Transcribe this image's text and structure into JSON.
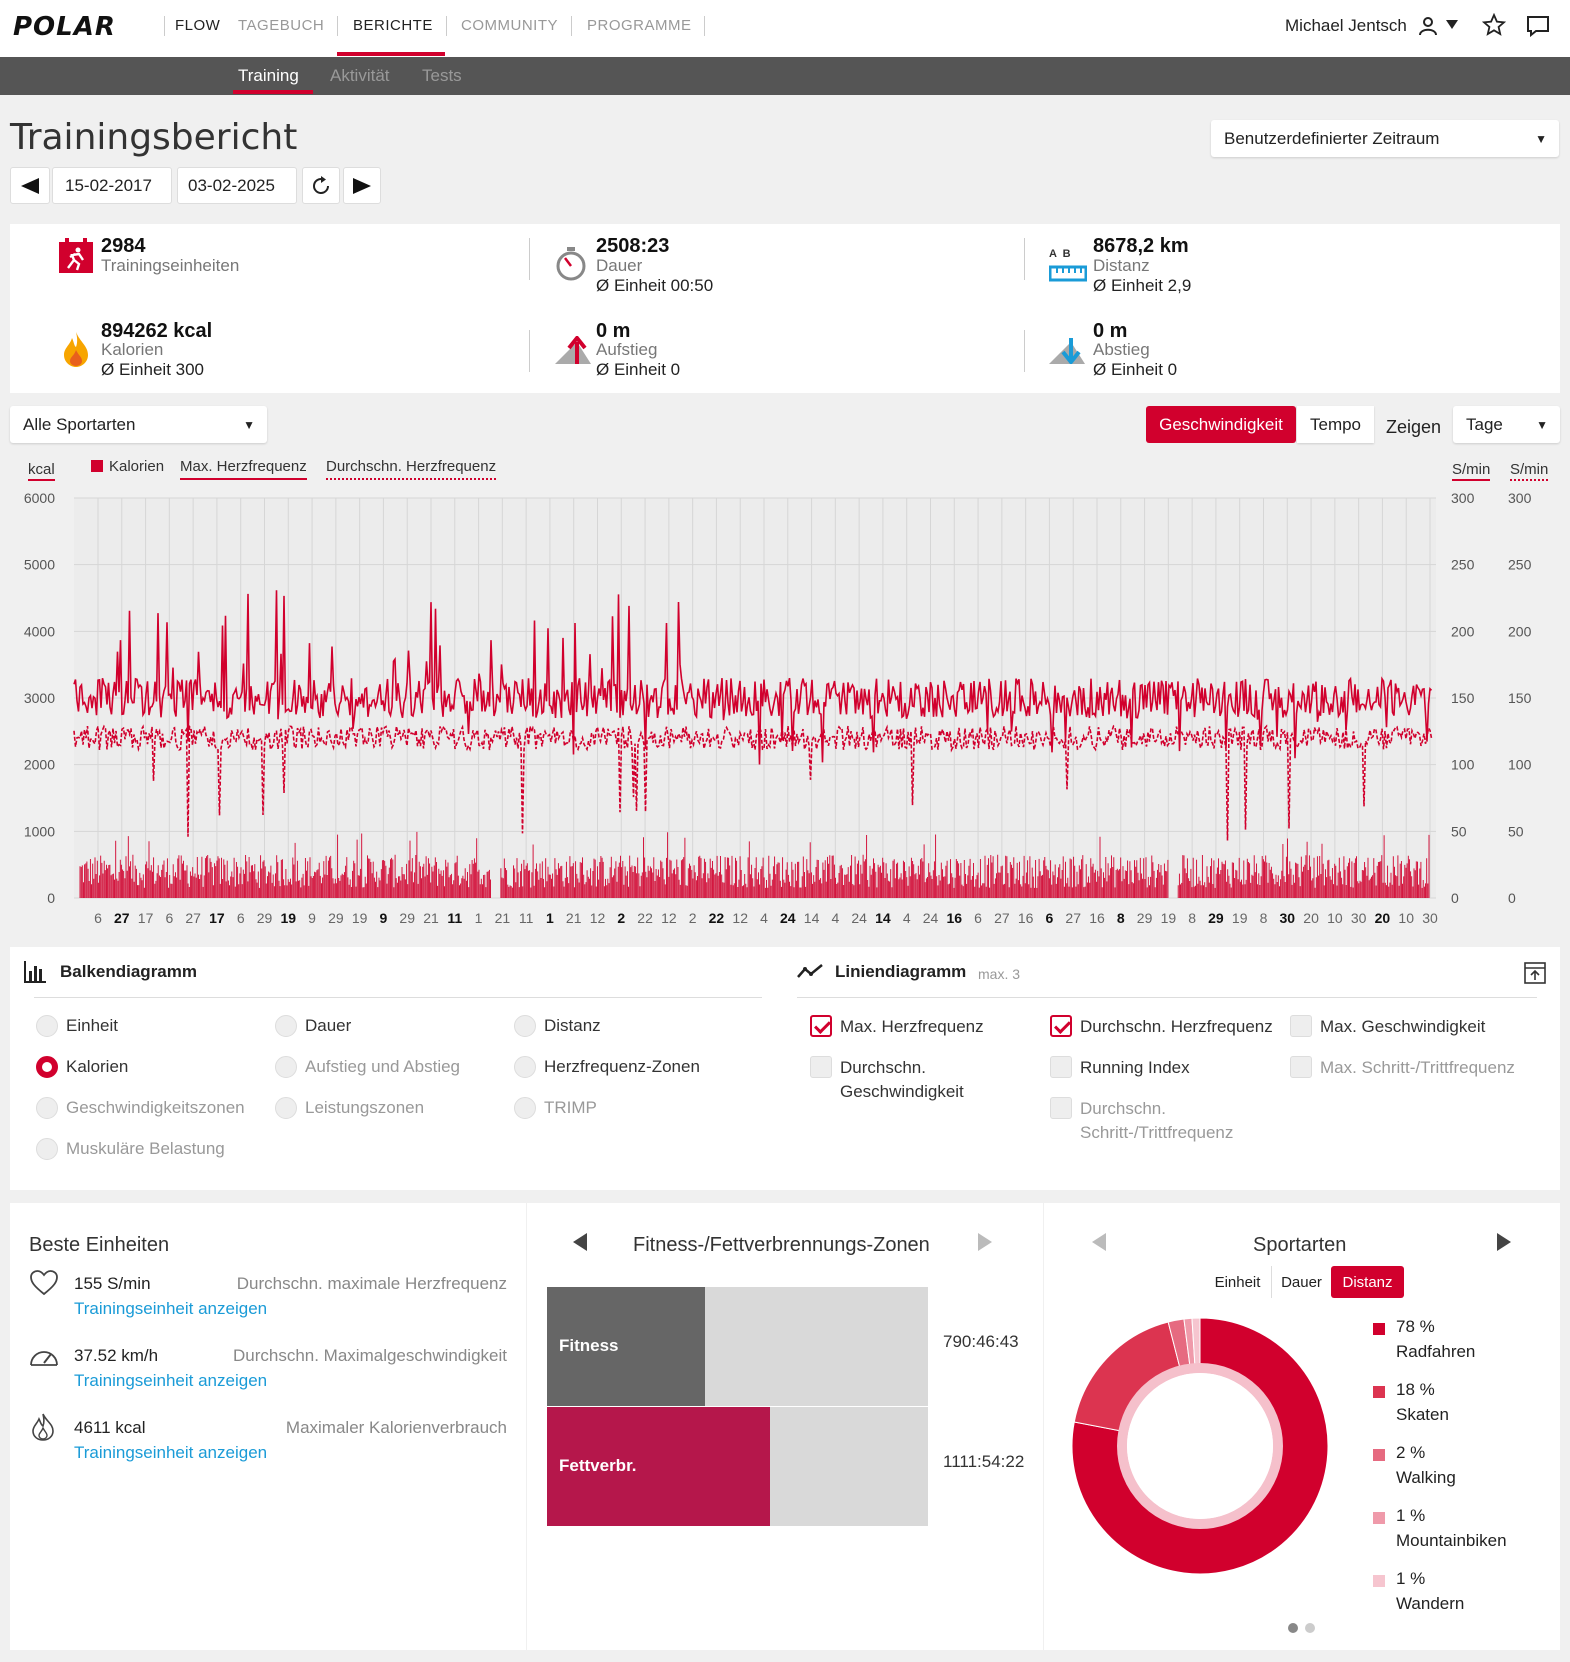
{
  "nav": {
    "brand": "POLAR",
    "flow": "FLOW",
    "items": [
      "TAGEBUCH",
      "BERICHTE",
      "COMMUNITY",
      "PROGRAMME"
    ],
    "active": "BERICHTE",
    "user": "Michael Jentsch"
  },
  "subnav": {
    "items": [
      "Training",
      "Aktivität",
      "Tests"
    ],
    "active": "Training"
  },
  "page": {
    "title": "Trainingsbericht",
    "date_from": "15-02-2017",
    "date_to": "03-02-2025",
    "period_select": "Benutzerdefinierter Zeitraum"
  },
  "summary": {
    "sessions": {
      "value": "2984",
      "label": "Trainingseinheiten"
    },
    "duration": {
      "value": "2508:23",
      "label": "Dauer",
      "avg": "Ø Einheit 00:50"
    },
    "distance": {
      "value": "8678,2 km",
      "label": "Distanz",
      "avg": "Ø Einheit 2,9",
      "icon_letters": "A  B"
    },
    "calories": {
      "value": "894262 kcal",
      "label": "Kalorien",
      "avg": "Ø Einheit 300"
    },
    "ascent": {
      "value": "0 m",
      "label": "Aufstieg",
      "avg": "Ø Einheit 0"
    },
    "descent": {
      "value": "0 m",
      "label": "Abstieg",
      "avg": "Ø Einheit 0"
    }
  },
  "filters": {
    "sport": "Alle Sportarten",
    "speed_toggle": [
      "Geschwindigkeit",
      "Tempo"
    ],
    "speed_active": "Geschwindigkeit",
    "show_label": "Zeigen",
    "granularity": "Tage"
  },
  "chart_data": {
    "type": "bar+line",
    "left_axis_unit": "kcal",
    "right_axis_units": [
      "S/min",
      "S/min"
    ],
    "legend": [
      "Kalorien",
      "Max. Herzfrequenz",
      "Durchschn. Herzfrequenz"
    ],
    "y_left": {
      "min": 0,
      "max": 6000,
      "ticks": [
        "6000",
        "5000",
        "4000",
        "3000",
        "2000",
        "1000",
        "0"
      ]
    },
    "y_right": {
      "min": 0,
      "max": 300,
      "ticks": [
        "300",
        "250",
        "200",
        "150",
        "100",
        "50",
        "0"
      ]
    },
    "x_ticks": [
      {
        "t": "6",
        "b": false
      },
      {
        "t": "27",
        "b": true
      },
      {
        "t": "17",
        "b": false
      },
      {
        "t": "6",
        "b": false
      },
      {
        "t": "27",
        "b": false
      },
      {
        "t": "17",
        "b": true
      },
      {
        "t": "6",
        "b": false
      },
      {
        "t": "29",
        "b": false
      },
      {
        "t": "19",
        "b": true
      },
      {
        "t": "9",
        "b": false
      },
      {
        "t": "29",
        "b": false
      },
      {
        "t": "19",
        "b": false
      },
      {
        "t": "9",
        "b": true
      },
      {
        "t": "29",
        "b": false
      },
      {
        "t": "21",
        "b": false
      },
      {
        "t": "11",
        "b": true
      },
      {
        "t": "1",
        "b": false
      },
      {
        "t": "21",
        "b": false
      },
      {
        "t": "11",
        "b": false
      },
      {
        "t": "1",
        "b": true
      },
      {
        "t": "21",
        "b": false
      },
      {
        "t": "12",
        "b": false
      },
      {
        "t": "2",
        "b": true
      },
      {
        "t": "22",
        "b": false
      },
      {
        "t": "12",
        "b": false
      },
      {
        "t": "2",
        "b": false
      },
      {
        "t": "22",
        "b": true
      },
      {
        "t": "12",
        "b": false
      },
      {
        "t": "4",
        "b": false
      },
      {
        "t": "24",
        "b": true
      },
      {
        "t": "14",
        "b": false
      },
      {
        "t": "4",
        "b": false
      },
      {
        "t": "24",
        "b": false
      },
      {
        "t": "14",
        "b": true
      },
      {
        "t": "4",
        "b": false
      },
      {
        "t": "24",
        "b": false
      },
      {
        "t": "16",
        "b": true
      },
      {
        "t": "6",
        "b": false
      },
      {
        "t": "27",
        "b": false
      },
      {
        "t": "16",
        "b": false
      },
      {
        "t": "6",
        "b": true
      },
      {
        "t": "27",
        "b": false
      },
      {
        "t": "16",
        "b": false
      },
      {
        "t": "8",
        "b": true
      },
      {
        "t": "29",
        "b": false
      },
      {
        "t": "19",
        "b": false
      },
      {
        "t": "8",
        "b": false
      },
      {
        "t": "29",
        "b": true
      },
      {
        "t": "19",
        "b": false
      },
      {
        "t": "8",
        "b": false
      },
      {
        "t": "30",
        "b": true
      },
      {
        "t": "20",
        "b": false
      },
      {
        "t": "10",
        "b": false
      },
      {
        "t": "30",
        "b": false
      },
      {
        "t": "20",
        "b": true
      },
      {
        "t": "10",
        "b": false
      },
      {
        "t": "30",
        "b": false
      }
    ],
    "series_summary": {
      "calories_typical_range": [
        150,
        650
      ],
      "calories_peaks": [
        1000,
        800
      ],
      "max_hr_typical": 150,
      "max_hr_peaks": [
        225,
        230
      ],
      "avg_hr_typical": 120,
      "avg_hr_dips": [
        50,
        40
      ]
    },
    "colors": {
      "red": "#d1002d",
      "grid": "#d8d8d8",
      "bg": "#ececec"
    }
  },
  "options": {
    "bar_title": "Balkendiagramm",
    "line_title": "Liniendiagramm",
    "line_max": "max. 3",
    "bar_options": [
      {
        "label": "Einheit",
        "state": "off"
      },
      {
        "label": "Dauer",
        "state": "off"
      },
      {
        "label": "Distanz",
        "state": "off"
      },
      {
        "label": "Kalorien",
        "state": "on"
      },
      {
        "label": "Aufstieg und Abstieg",
        "state": "dim"
      },
      {
        "label": "Herzfrequenz-Zonen",
        "state": "off"
      },
      {
        "label": "Geschwindigkeitszonen",
        "state": "dim"
      },
      {
        "label": "Leistungszonen",
        "state": "dim"
      },
      {
        "label": "TRIMP",
        "state": "dim"
      },
      {
        "label": "Muskuläre Belastung",
        "state": "dim"
      }
    ],
    "line_options": [
      {
        "label": "Max. Herzfrequenz",
        "state": "on"
      },
      {
        "label": "Durchschn. Herzfrequenz",
        "state": "on"
      },
      {
        "label": "Max. Geschwindigkeit",
        "state": "off"
      },
      {
        "label": "Durchschn. Geschwindigkeit",
        "state": "off"
      },
      {
        "label": "Running Index",
        "state": "off"
      },
      {
        "label": "Max. Schritt-/Trittfrequenz",
        "state": "dim"
      },
      {
        "label": "Durchschn. Schritt-/Trittfrequenz",
        "state": "dim"
      }
    ]
  },
  "best": {
    "title": "Beste Einheiten",
    "items": [
      {
        "value": "155 S/min",
        "label": "Durchschn. maximale Herzfrequenz",
        "link": "Trainingseinheit anzeigen",
        "icon": "heart-icon"
      },
      {
        "value": "37.52 km/h",
        "label": "Durchschn. Maximalgeschwindigkeit",
        "link": "Trainingseinheit anzeigen",
        "icon": "speedometer-icon"
      },
      {
        "value": "4611 kcal",
        "label": "Maximaler Kalorienverbrauch",
        "link": "Trainingseinheit anzeigen",
        "icon": "flame-icon"
      }
    ]
  },
  "zones": {
    "title": "Fitness-/Fettverbrennungs-Zonen",
    "bars": [
      {
        "label": "Fitness",
        "time": "790:46:43",
        "fraction": 0.415,
        "color": "#666666"
      },
      {
        "label": "Fettverbr.",
        "time": "1111:54:22",
        "fraction": 0.585,
        "color": "#b5174b"
      }
    ]
  },
  "sports": {
    "title": "Sportarten",
    "tabs": [
      "Einheit",
      "Dauer",
      "Distanz"
    ],
    "active_tab": "Distanz",
    "slices": [
      {
        "pct": "78 %",
        "value": 78,
        "name": "Radfahren",
        "color": "#d1002d"
      },
      {
        "pct": "18 %",
        "value": 18,
        "name": "Skaten",
        "color": "#dc3450"
      },
      {
        "pct": "2 %",
        "value": 2,
        "name": "Walking",
        "color": "#e66a80"
      },
      {
        "pct": "1 %",
        "value": 1,
        "name": "Mountainbiken",
        "color": "#ef9aaa"
      },
      {
        "pct": "1 %",
        "value": 1,
        "name": "Wandern",
        "color": "#f6c5cf"
      }
    ]
  }
}
